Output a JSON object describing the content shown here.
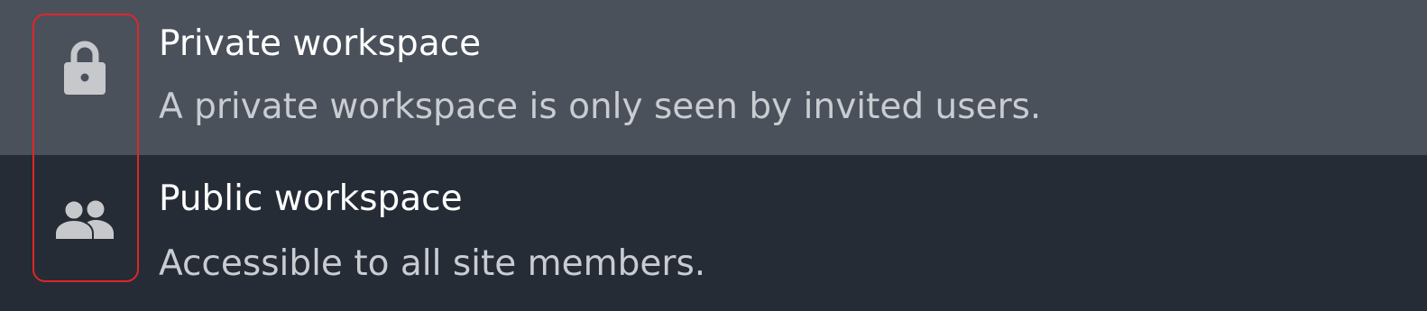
{
  "options": [
    {
      "icon": "lock-icon",
      "title": "Private workspace",
      "description": "A private workspace is only seen by invited users.",
      "highlighted": true
    },
    {
      "icon": "people-icon",
      "title": "Public workspace",
      "description": "Accessible to all site members.",
      "highlighted": false
    }
  ],
  "colors": {
    "highlighted_bg": "#4a515b",
    "bg": "#262c36",
    "title": "#ffffff",
    "description": "#c9ccd1",
    "icon": "#c6c8cc",
    "focus_ring": "#e0252a"
  }
}
